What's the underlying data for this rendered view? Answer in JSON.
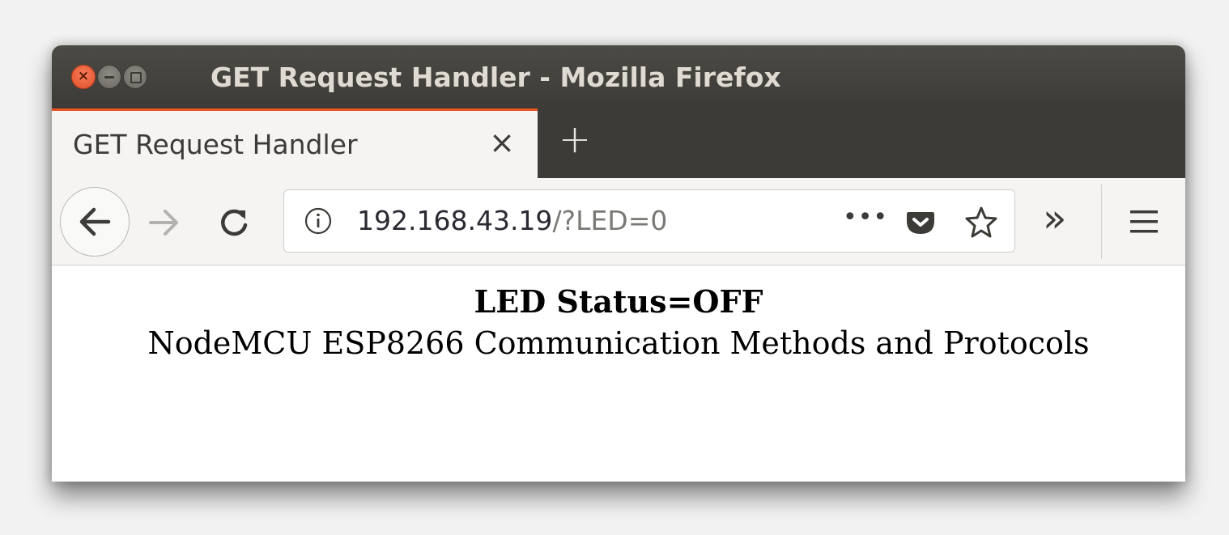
{
  "window": {
    "title": "GET Request Handler - Mozilla Firefox",
    "close_glyph": "×"
  },
  "tabs": [
    {
      "label": "GET Request Handler",
      "close_glyph": "×",
      "active": true
    }
  ],
  "new_tab_glyph": "+",
  "toolbar": {
    "back_icon": "back-arrow-icon",
    "forward_icon": "forward-arrow-icon",
    "reload_icon": "reload-icon",
    "overflow_glyph": "»",
    "menu_icon": "hamburger-menu-icon"
  },
  "urlbar": {
    "host": "192.168.43.19",
    "path": "/?LED=0",
    "page_actions_glyph": "•••",
    "icons": [
      "info-icon",
      "pocket-icon",
      "bookmark-star-icon"
    ]
  },
  "page": {
    "status_line": "LED Status=OFF",
    "subtitle": "NodeMCU ESP8266 Communication Methods and Protocols"
  },
  "colors": {
    "titlebar": "#3d3b37",
    "tab_accent": "#e95420",
    "close_button": "#e2502a",
    "toolbar": "#f5f4f3"
  }
}
